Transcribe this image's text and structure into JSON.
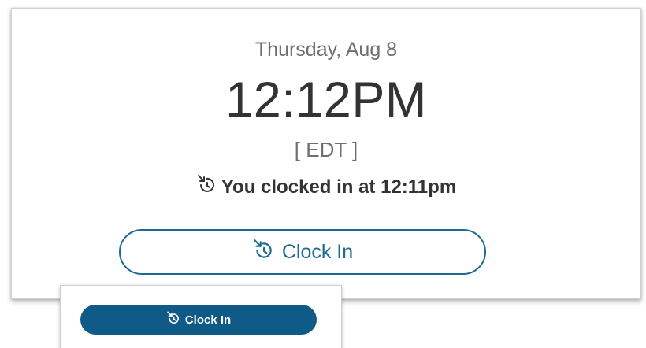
{
  "clock_card": {
    "date": "Thursday, Aug 8",
    "time": "12:12PM",
    "timezone": "[ EDT ]",
    "status_text": "You clocked in at 12:11pm",
    "status_icon": "clock-in-icon",
    "button_label": "Clock In",
    "button_icon": "clock-in-icon"
  },
  "inset_card": {
    "button_label": "Clock In",
    "button_icon": "clock-in-icon"
  },
  "colors": {
    "accent": "#1e6a93",
    "accent_solid": "#0f5a86",
    "text_dark": "#333333",
    "text_muted": "#6f6f6f"
  }
}
